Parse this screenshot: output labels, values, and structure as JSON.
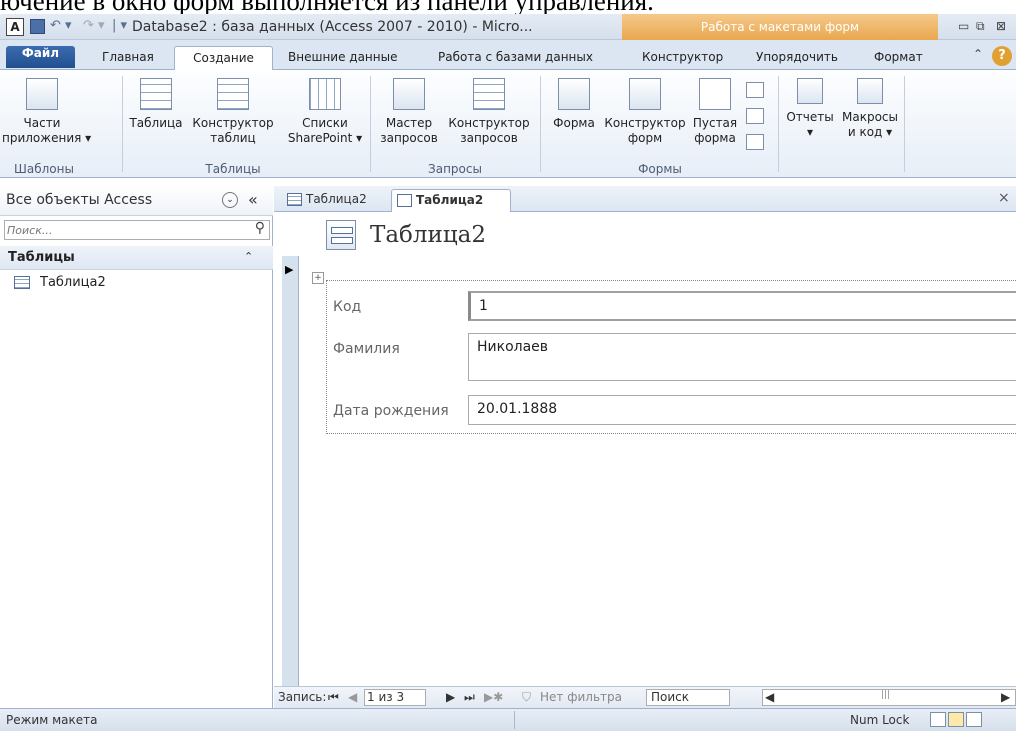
{
  "background_caption": "ючение в окно форм выполняется из панели управления.",
  "titlebar": {
    "app_icon": "A",
    "title": "Database2 : база данных (Access 2007 - 2010)  -  Micro...",
    "context_title": "Работа с макетами форм",
    "min": "▭",
    "max": "⧉",
    "close": "⊠",
    "undo": "↶ ▾",
    "redo": "↷ ▾",
    "qat_sep": "| ▾"
  },
  "tabs": {
    "file": "Файл",
    "home": "Главная",
    "create": "Создание",
    "external": "Внешние данные",
    "database": "Работа с базами данных",
    "designer": "Конструктор",
    "arrange": "Упорядочить",
    "format": "Формат",
    "help": "?",
    "caret": "⌃"
  },
  "ribbon": {
    "parts_l1": "Части",
    "parts_l2": "приложения ▾",
    "table": "Таблица",
    "table_designer_l1": "Конструктор",
    "table_designer_l2": "таблиц",
    "sharepoint_l1": "Списки",
    "sharepoint_l2": "SharePoint ▾",
    "query_wizard_l1": "Мастер",
    "query_wizard_l2": "запросов",
    "query_designer_l1": "Конструктор",
    "query_designer_l2": "запросов",
    "form": "Форма",
    "form_designer_l1": "Конструктор",
    "form_designer_l2": "форм",
    "blank_form_l1": "Пустая",
    "blank_form_l2": "форма",
    "reports_l1": "Отчеты",
    "reports_l2": "▾",
    "macros_l1": "Макросы",
    "macros_l2": "и код ▾",
    "group_templates": "Шаблоны",
    "group_tables": "Таблицы",
    "group_queries": "Запросы",
    "group_forms": "Формы"
  },
  "nav": {
    "title": "Все объекты Access",
    "drop": "⌄",
    "collapse": "«",
    "search_placeholder": "Поиск...",
    "search_icon": "⚲",
    "group": "Таблицы",
    "group_caret": "⌃",
    "item": "Таблица2"
  },
  "doc": {
    "tab1": "Таблица2",
    "tab2": "Таблица2",
    "close": "×",
    "form_title": "Таблица2",
    "move_handle": "+",
    "record_arrow": "▶",
    "fields": [
      {
        "label": "Код",
        "value": "1"
      },
      {
        "label": "Фамилия",
        "value": "Николаев"
      },
      {
        "label": "Дата рождения",
        "value": "20.01.1888"
      }
    ]
  },
  "recordnav": {
    "label": "Запись:",
    "first": "⏮",
    "prev": "◀",
    "position": "1 из 3",
    "next": "▶",
    "last": "⏭",
    "new": "▶✱",
    "filter_icon": "⛉",
    "filter": "Нет фильтра",
    "search": "Поиск",
    "scroll_left": "◀",
    "scroll_mid": "|||",
    "scroll_right": "▶"
  },
  "status": {
    "mode": "Режим макета",
    "numlock": "Num Lock"
  }
}
